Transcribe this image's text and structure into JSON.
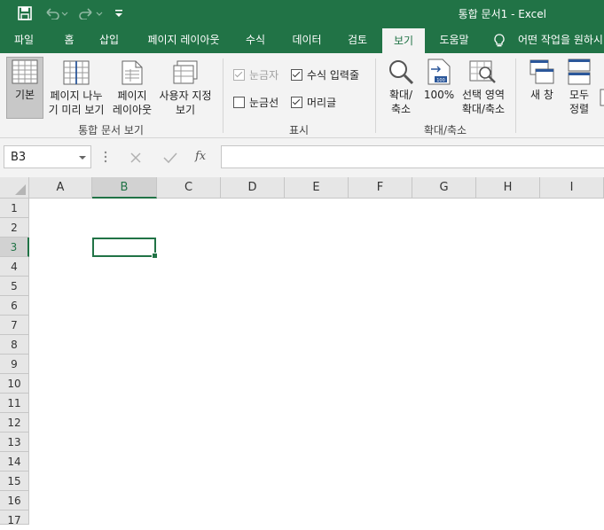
{
  "titlebar": {
    "title": "통합 문서1  -  Excel",
    "icons": [
      "save-icon",
      "undo-icon",
      "redo-icon",
      "customize-qat-icon"
    ]
  },
  "tabs": [
    "파일",
    "홈",
    "삽입",
    "페이지 레이아웃",
    "수식",
    "데이터",
    "검토",
    "보기",
    "도움말"
  ],
  "active_tab": "보기",
  "tell_me": "어떤 작업을 원하시",
  "ribbon": {
    "workbook_views": {
      "label": "통합 문서 보기",
      "normal": "기본",
      "page_break": "페이지 나누\n기 미리 보기",
      "page_layout": "페이지\n레이아웃",
      "custom_views": "사용자 지정\n보기"
    },
    "show": {
      "label": "표시",
      "ruler": "눈금자",
      "gridlines": "눈금선",
      "formula_bar": "수식 입력줄",
      "headings": "머리글"
    },
    "zoom": {
      "label": "확대/축소",
      "zoom": "확대/\n축소",
      "zoom_100": "100%",
      "zoom_selection": "선택 영역\n확대/축소"
    },
    "window": {
      "new_window": "새 창",
      "arrange_all": "모두\n정렬"
    }
  },
  "formula_bar": {
    "name_box": "B3",
    "fx": "fx",
    "value": ""
  },
  "sheet": {
    "columns": [
      "A",
      "B",
      "C",
      "D",
      "E",
      "F",
      "G",
      "H",
      "I"
    ],
    "rows": [
      "1",
      "2",
      "3",
      "4",
      "5",
      "6",
      "7",
      "8",
      "9",
      "10",
      "11",
      "12",
      "13",
      "14",
      "15",
      "16",
      "17"
    ],
    "selected_cell": "B3",
    "accent": "#217346"
  }
}
